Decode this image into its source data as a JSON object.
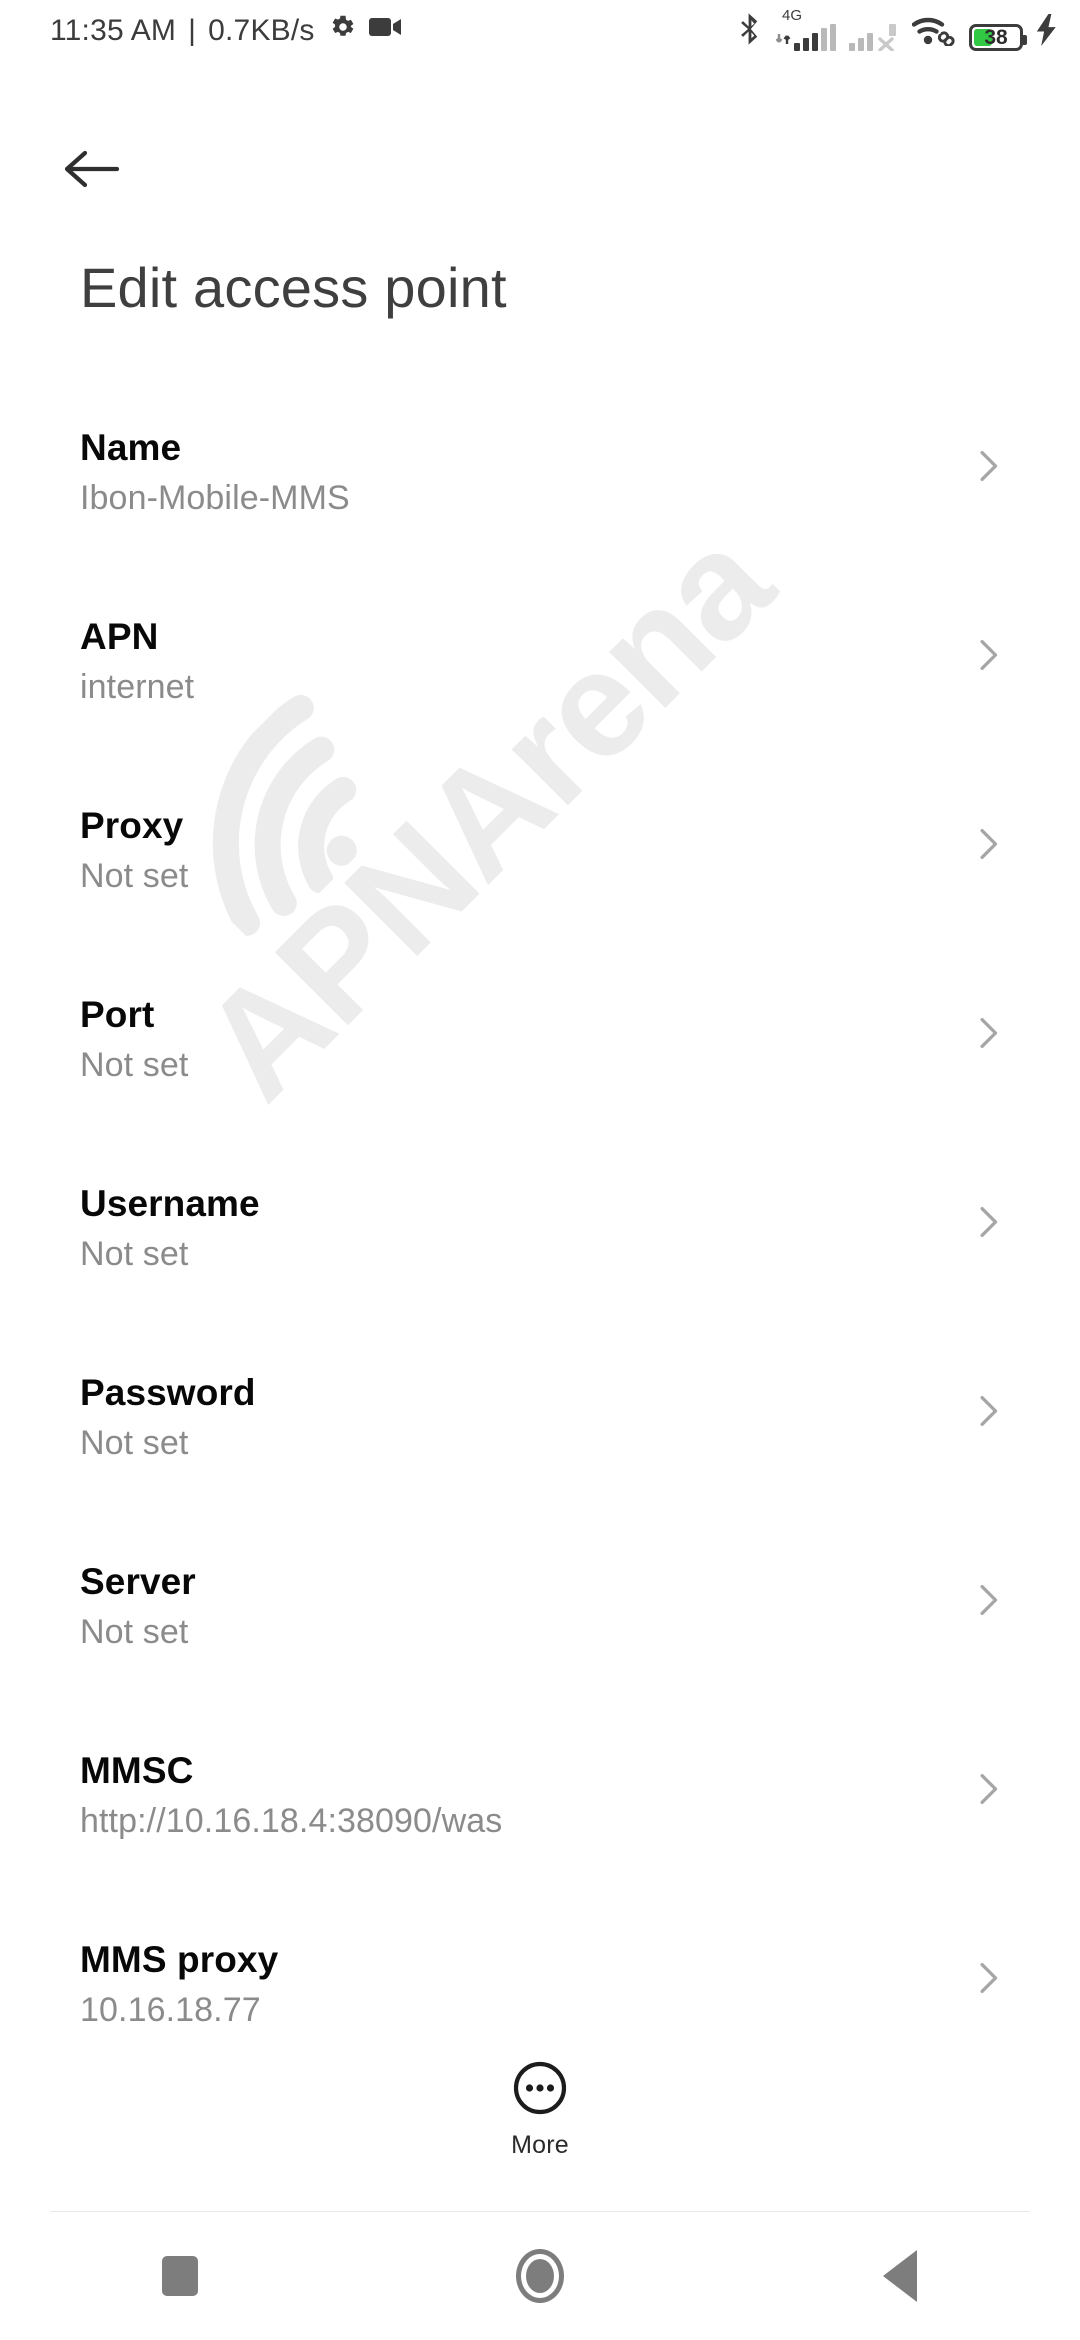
{
  "status_bar": {
    "time": "11:35 AM",
    "separator": "|",
    "network_speed": "0.7KB/s",
    "icons_left": [
      "gear-icon",
      "video-camera-icon"
    ],
    "icons_right": [
      "bluetooth-icon",
      "signal-4g-icon",
      "signal-sim2-off-icon",
      "wifi-linked-icon",
      "battery-icon",
      "charging-bolt-icon"
    ],
    "network_generation": "4G",
    "battery_percent": "38",
    "battery_color": "#31c943"
  },
  "app_bar": {
    "back_icon": "arrow-back-icon",
    "title": "Edit access point"
  },
  "watermark": {
    "text": "APNArena",
    "color": "#ececec"
  },
  "settings": {
    "rows": [
      {
        "label": "Name",
        "value": "Ibon-Mobile-MMS"
      },
      {
        "label": "APN",
        "value": "internet"
      },
      {
        "label": "Proxy",
        "value": "Not set"
      },
      {
        "label": "Port",
        "value": "Not set"
      },
      {
        "label": "Username",
        "value": "Not set"
      },
      {
        "label": "Password",
        "value": "Not set"
      },
      {
        "label": "Server",
        "value": "Not set"
      },
      {
        "label": "MMSC",
        "value": "http://10.16.18.4:38090/was"
      },
      {
        "label": "MMS proxy",
        "value": "10.16.18.77"
      }
    ]
  },
  "more_button": {
    "label": "More",
    "icon": "more-circle-icon"
  },
  "nav_bar": {
    "recents_label": "recents-icon",
    "home_label": "home-icon",
    "back_label": "back-icon",
    "color": "#7d7d7d"
  }
}
